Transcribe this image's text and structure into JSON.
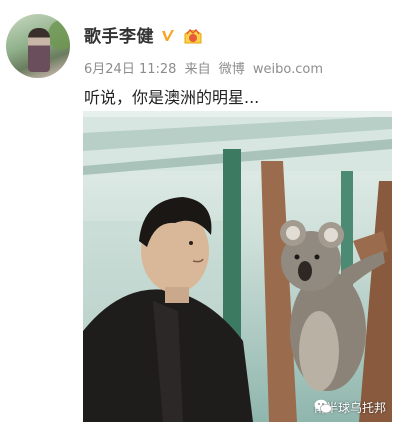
{
  "user": {
    "name": "歌手李健",
    "avatar_icon": "avatar-photo",
    "verified_icon": "verified-v-icon",
    "vip_icon": "vip-badge-icon",
    "verified_color": "#f5a623"
  },
  "meta": {
    "date": "6月24日 11:28",
    "source_prefix": "来自",
    "source_name": "微博",
    "source_url": "weibo.com"
  },
  "post": {
    "text": "听说，你是澳洲的明星..."
  },
  "photo": {
    "description_icon": "koala-photo",
    "watermark_text": "南半球乌托邦",
    "watermark_icon": "wechat-icon"
  }
}
